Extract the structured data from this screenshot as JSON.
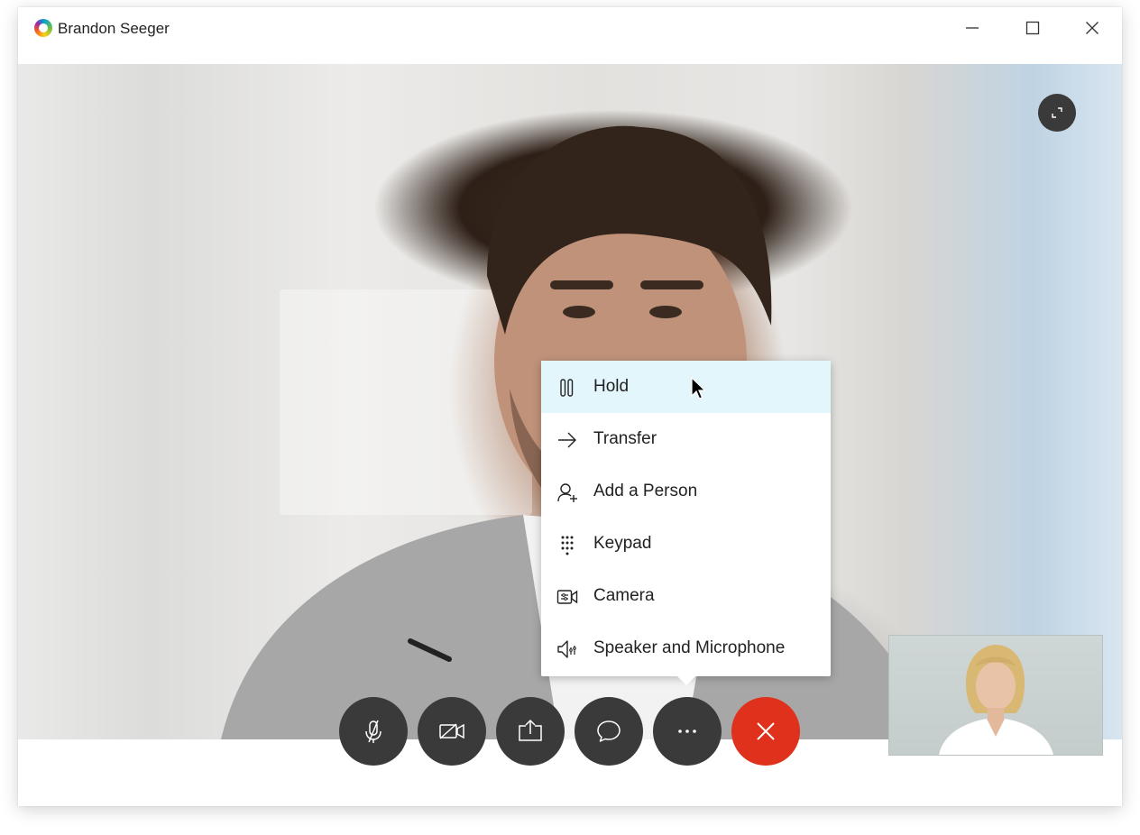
{
  "window": {
    "title": "Brandon Seeger"
  },
  "menu": {
    "items": [
      {
        "label": "Hold",
        "icon": "pause-icon",
        "active": true
      },
      {
        "label": "Transfer",
        "icon": "arrow-right-icon"
      },
      {
        "label": "Add a Person",
        "icon": "add-person-icon"
      },
      {
        "label": "Keypad",
        "icon": "keypad-icon"
      },
      {
        "label": "Camera",
        "icon": "camera-settings-icon"
      },
      {
        "label": "Speaker and Microphone",
        "icon": "speaker-mic-icon"
      }
    ]
  },
  "controls": [
    {
      "name": "mute",
      "icon": "microphone-muted-icon"
    },
    {
      "name": "video",
      "icon": "video-off-icon"
    },
    {
      "name": "share",
      "icon": "share-screen-icon"
    },
    {
      "name": "chat",
      "icon": "chat-icon"
    },
    {
      "name": "more",
      "icon": "more-icon"
    },
    {
      "name": "end-call",
      "icon": "close-icon"
    }
  ],
  "colors": {
    "end_call": "#e0311c",
    "control_bg": "#3a3a3a",
    "menu_highlight": "#e2f6fb"
  }
}
